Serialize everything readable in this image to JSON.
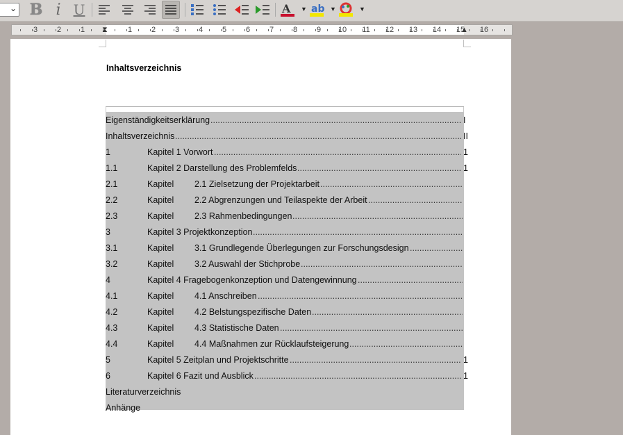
{
  "toolbar": {
    "font_select_value": "",
    "buttons": [
      {
        "name": "bold-button",
        "icon": "bold-icon",
        "glyph": "B"
      },
      {
        "name": "italic-button",
        "icon": "italic-icon",
        "glyph": "i"
      },
      {
        "name": "underline-button",
        "icon": "underline-icon",
        "glyph": "U"
      },
      {
        "name": "align-left-button",
        "icon": "align-left-icon"
      },
      {
        "name": "align-center-button",
        "icon": "align-center-icon"
      },
      {
        "name": "align-right-button",
        "icon": "align-right-icon"
      },
      {
        "name": "justify-button",
        "icon": "align-justify-icon",
        "active": true
      },
      {
        "name": "numbered-list-button",
        "icon": "numbered-list-icon"
      },
      {
        "name": "bullet-list-button",
        "icon": "bullet-list-icon"
      },
      {
        "name": "decrease-indent-button",
        "icon": "decrease-indent-icon"
      },
      {
        "name": "increase-indent-button",
        "icon": "increase-indent-icon"
      },
      {
        "name": "font-color-button",
        "icon": "font-color-icon"
      },
      {
        "name": "highlight-button",
        "icon": "highlight-icon"
      },
      {
        "name": "background-color-button",
        "icon": "background-color-icon"
      }
    ]
  },
  "ruler": {
    "labels": [
      "3",
      "2",
      "1",
      "1",
      "2",
      "3",
      "4",
      "5",
      "6",
      "7",
      "8",
      "9",
      "10",
      "11",
      "12",
      "13",
      "14",
      "15",
      "16"
    ]
  },
  "document": {
    "heading": "Inhaltsverzeichnis",
    "toc": [
      {
        "num": "Eigenständigkeitserklärung",
        "t1": "",
        "t2": "",
        "page": "I"
      },
      {
        "num": "Inhaltsverzeichnis",
        "t1": "",
        "t2": "",
        "page": "II"
      },
      {
        "num": "1",
        "t1": "Kapitel 1 Vorwort",
        "t2": "",
        "page": "1"
      },
      {
        "num": "1.1",
        "t1": "Kapitel 2 Darstellung des Problemfelds",
        "t2": "",
        "page": "1"
      },
      {
        "num": "2.1",
        "t1": "Kapitel",
        "t2": "2.1 Zielsetzung der Projektarbeit",
        "page": ""
      },
      {
        "num": "2.2",
        "t1": "Kapitel",
        "t2": "2.2 Abgrenzungen und Teilaspekte der Arbeit",
        "page": ""
      },
      {
        "num": "2.3",
        "t1": "Kapitel",
        "t2": "2.3 Rahmenbedingungen",
        "page": ""
      },
      {
        "num": "3",
        "t1": "Kapitel 3 Projektkonzeption",
        "t2": "",
        "page": ""
      },
      {
        "num": "3.1",
        "t1": "Kapitel",
        "t2": "3.1 Grundlegende Überlegungen zur Forschungsdesign",
        "page": ""
      },
      {
        "num": "3.2",
        "t1": "Kapitel",
        "t2": "3.2 Auswahl der Stichprobe",
        "page": ""
      },
      {
        "num": "4",
        "t1": "Kapitel 4 Fragebogenkonzeption und Datengewinnung",
        "t2": "",
        "page": ""
      },
      {
        "num": "4.1",
        "t1": "Kapitel",
        "t2": "4.1 Anschreiben",
        "page": ""
      },
      {
        "num": "4.2",
        "t1": "Kapitel",
        "t2": "4.2 Belstungspezifische Daten",
        "page": ""
      },
      {
        "num": "4.3",
        "t1": "Kapitel",
        "t2": "4.3 Statistische Daten",
        "page": ""
      },
      {
        "num": "4.4",
        "t1": "Kapitel",
        "t2": "4.4 Maßnahmen zur Rücklaufsteigerung",
        "page": ""
      },
      {
        "num": "5",
        "t1": "Kapitel 5 Zeitplan und Projektschritte",
        "t2": "",
        "page": "1"
      },
      {
        "num": "6",
        "t1": "Kapitel 6 Fazit und Ausblick",
        "t2": "",
        "page": "1"
      },
      {
        "num": "Literaturverzeichnis",
        "t1": "",
        "t2": "",
        "page": ""
      },
      {
        "num": "Anhänge",
        "t1": "",
        "t2": "",
        "page": ""
      }
    ]
  }
}
